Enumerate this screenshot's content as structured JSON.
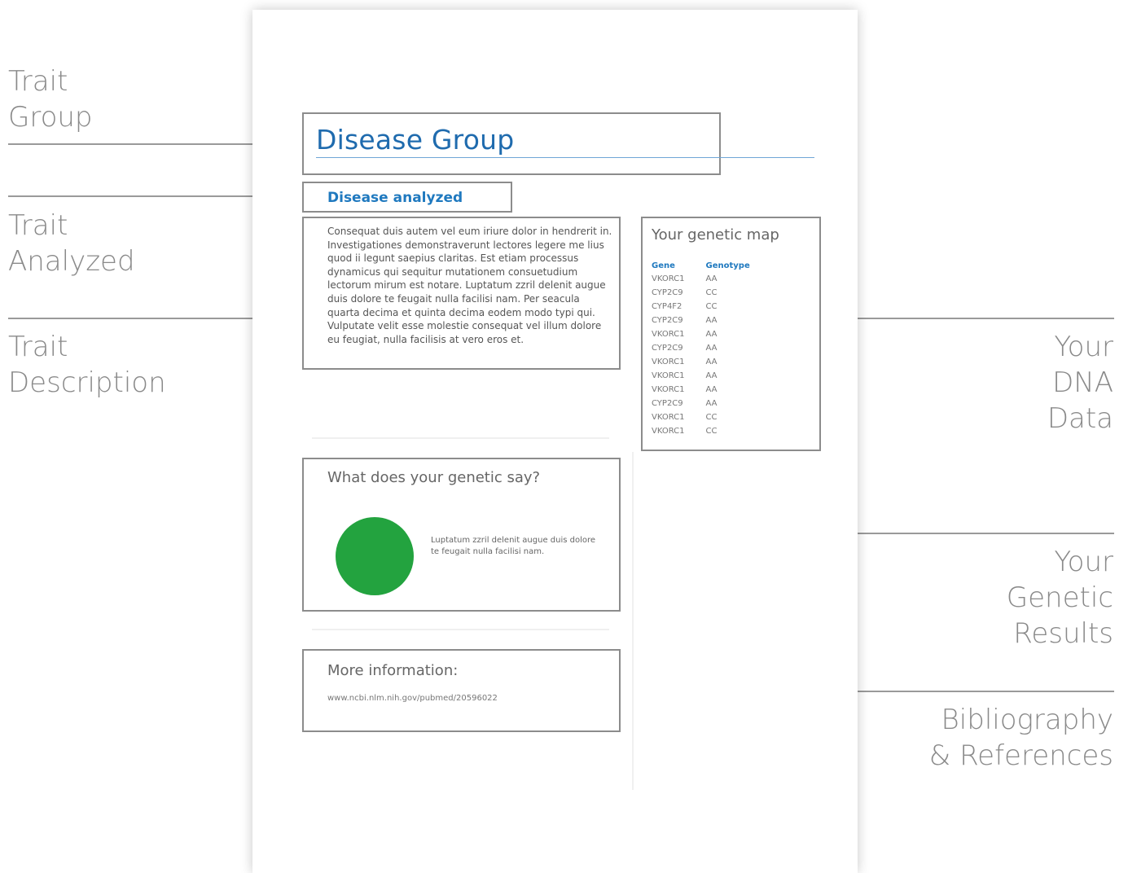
{
  "labels": {
    "trait_group": "Trait\nGroup",
    "trait_analyzed": "Trait\nAnalyzed",
    "trait_description": "Trait\nDescription",
    "your_dna_data": "Your\nDNA\nData",
    "your_genetic_results": "Your\nGenetic\nResults",
    "bibliography": "Bibliography\n& References"
  },
  "report": {
    "group_title": "Disease Group",
    "analyzed_title": "Disease analyzed",
    "description": "Consequat duis autem vel eum iriure dolor in hendrerit in. Investigationes demonstraverunt lectores legere me lius quod ii legunt saepius claritas. Est etiam processus dynamicus qui sequitur mutationem consuetudium lectorum mirum est notare. Luptatum zzril delenit augue duis dolore te feugait nulla facilisi nam. Per seacula quarta decima et quinta decima eodem modo typi qui. Vulputate velit esse molestie consequat vel illum dolore eu feugiat, nulla facilisis at vero eros et.",
    "genetic_map": {
      "title": "Your genetic map",
      "headers": [
        "Gene",
        "Genotype"
      ],
      "rows": [
        [
          "VKORC1",
          "AA"
        ],
        [
          "CYP2C9",
          "CC"
        ],
        [
          "CYP4F2",
          "CC"
        ],
        [
          "CYP2C9",
          "AA"
        ],
        [
          "VKORC1",
          "AA"
        ],
        [
          "CYP2C9",
          "AA"
        ],
        [
          "VKORC1",
          "AA"
        ],
        [
          "VKORC1",
          "AA"
        ],
        [
          "VKORC1",
          "AA"
        ],
        [
          "CYP2C9",
          "AA"
        ],
        [
          "VKORC1",
          "CC"
        ],
        [
          "VKORC1",
          "CC"
        ]
      ]
    },
    "genetic_say": {
      "title": "What does your genetic say?",
      "result_color": "#23a33f",
      "text": "Luptatum zzril delenit augue duis dolore te feugait nulla facilisi nam."
    },
    "more_info": {
      "title": "More information:",
      "link": "www.ncbi.nlm.nih.gov/pubmed/20596022"
    }
  }
}
